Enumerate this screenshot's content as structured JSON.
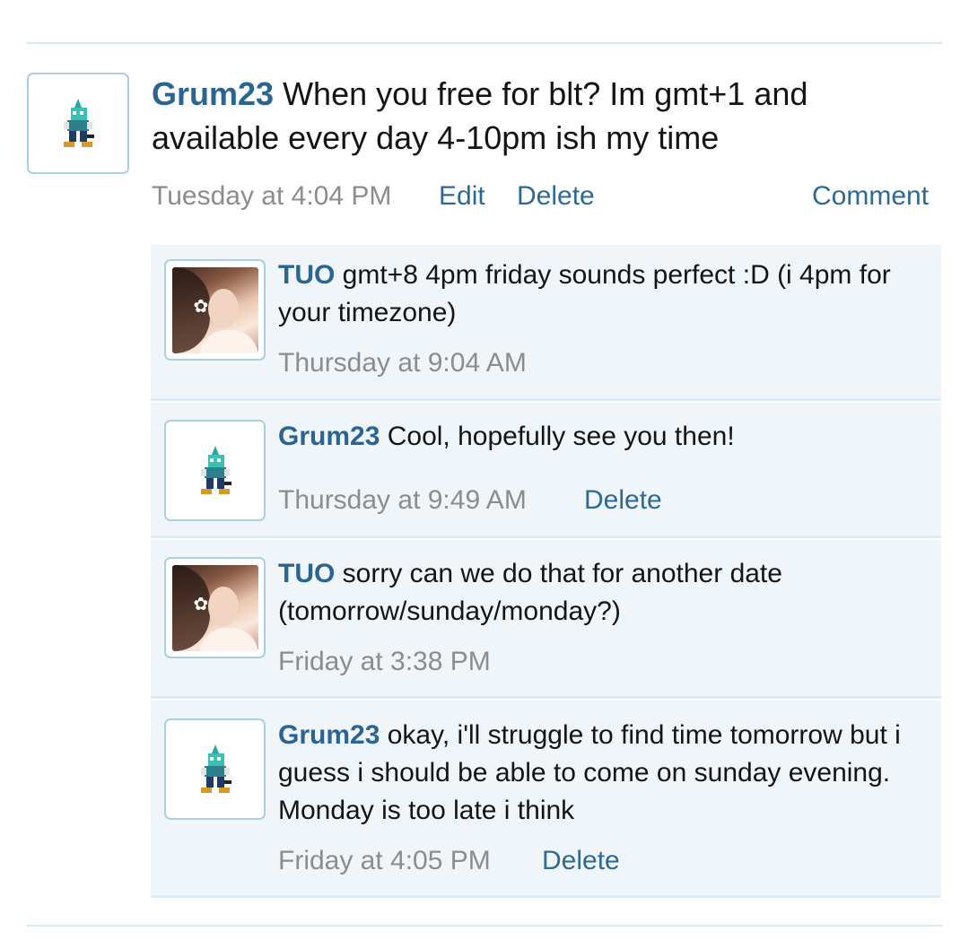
{
  "post": {
    "author": "Grum23",
    "message": "When you free for blt? Im gmt+1 and available every day 4-10pm ish my time",
    "timestamp": "Tuesday at 4:04 PM",
    "edit_label": "Edit",
    "delete_label": "Delete",
    "comment_label": "Comment",
    "avatar_icon": "pokemon-sprite-icon"
  },
  "comments": [
    {
      "author": "TUO",
      "message": "gmt+8 4pm friday sounds perfect :D (i 4pm for your timezone)",
      "timestamp": "Thursday at 9:04 AM",
      "avatar_icon": "profile-photo"
    },
    {
      "author": "Grum23",
      "message": "Cool, hopefully see you then!",
      "timestamp": "Thursday at 9:49 AM",
      "delete_label": "Delete",
      "avatar_icon": "pokemon-sprite-icon"
    },
    {
      "author": "TUO",
      "message": "sorry can we do that for another date (tomorrow/sunday/monday?)",
      "timestamp": "Friday at 3:38 PM",
      "avatar_icon": "profile-photo"
    },
    {
      "author": "Grum23",
      "message": "okay, i'll struggle to find time tomorrow but i guess i should be able to come on sunday evening. Monday is too late i think",
      "timestamp": "Friday at 4:05 PM",
      "delete_label": "Delete",
      "avatar_icon": "pokemon-sprite-icon"
    }
  ],
  "colors": {
    "username": "#2a6592",
    "link": "#2d6a93",
    "meta": "#8c8c8c",
    "comment_bg": "#f0f5fa",
    "divider": "#d8e9f3"
  }
}
